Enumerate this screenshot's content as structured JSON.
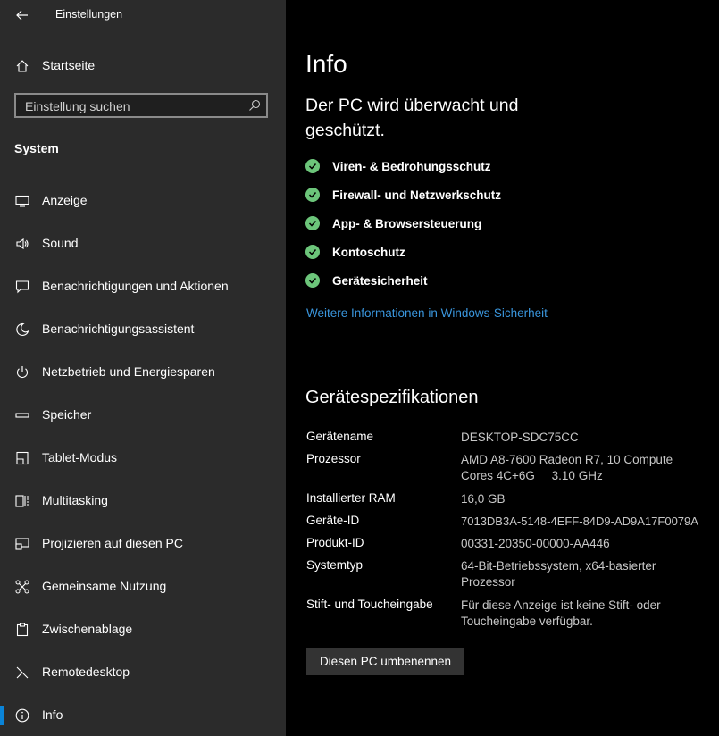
{
  "app": {
    "title": "Einstellungen"
  },
  "sidebar": {
    "home_label": "Startseite",
    "search_placeholder": "Einstellung suchen",
    "section_title": "System",
    "items": [
      {
        "label": "Anzeige",
        "icon": "monitor-icon"
      },
      {
        "label": "Sound",
        "icon": "speaker-icon"
      },
      {
        "label": "Benachrichtigungen und Aktionen",
        "icon": "notification-icon"
      },
      {
        "label": "Benachrichtigungsassistent",
        "icon": "moon-icon"
      },
      {
        "label": "Netzbetrieb und Energiesparen",
        "icon": "power-icon"
      },
      {
        "label": "Speicher",
        "icon": "storage-icon"
      },
      {
        "label": "Tablet-Modus",
        "icon": "tablet-icon"
      },
      {
        "label": "Multitasking",
        "icon": "multitasking-icon"
      },
      {
        "label": "Projizieren auf diesen PC",
        "icon": "project-icon"
      },
      {
        "label": "Gemeinsame Nutzung",
        "icon": "share-icon"
      },
      {
        "label": "Zwischenablage",
        "icon": "clipboard-icon"
      },
      {
        "label": "Remotedesktop",
        "icon": "remote-icon"
      },
      {
        "label": "Info",
        "icon": "info-icon",
        "active": true
      }
    ]
  },
  "main": {
    "title": "Info",
    "headline": "Der PC wird überwacht und geschützt.",
    "security_items": [
      "Viren- & Bedrohungsschutz",
      "Firewall- und Netzwerkschutz",
      "App- & Browsersteuerung",
      "Kontoschutz",
      "Gerätesicherheit"
    ],
    "security_link": "Weitere Informationen in Windows-Sicherheit",
    "specs_title": "Gerätespezifikationen",
    "specs": [
      {
        "key": "Gerätename",
        "value": "DESKTOP-SDC75CC"
      },
      {
        "key": "Prozessor",
        "value": "AMD A8-7600 Radeon R7, 10 Compute Cores 4C+6G     3.10 GHz"
      },
      {
        "key": "Installierter RAM",
        "value": "16,0 GB"
      },
      {
        "key": "Geräte-ID",
        "value": "7013DB3A-5148-4EFF-84D9-AD9A17F0079A"
      },
      {
        "key": "Produkt-ID",
        "value": "00331-20350-00000-AA446"
      },
      {
        "key": "Systemtyp",
        "value": "64-Bit-Betriebssystem, x64-basierter Prozessor"
      },
      {
        "key": "Stift- und Toucheingabe",
        "value": "Für diese Anzeige ist keine Stift- oder Toucheingabe verfügbar."
      }
    ],
    "rename_button": "Diesen PC umbenennen"
  },
  "colors": {
    "accent": "#0a84d8",
    "link": "#3a96dd",
    "check": "#6cc57a",
    "sidebar_bg": "#2b2b2b"
  }
}
